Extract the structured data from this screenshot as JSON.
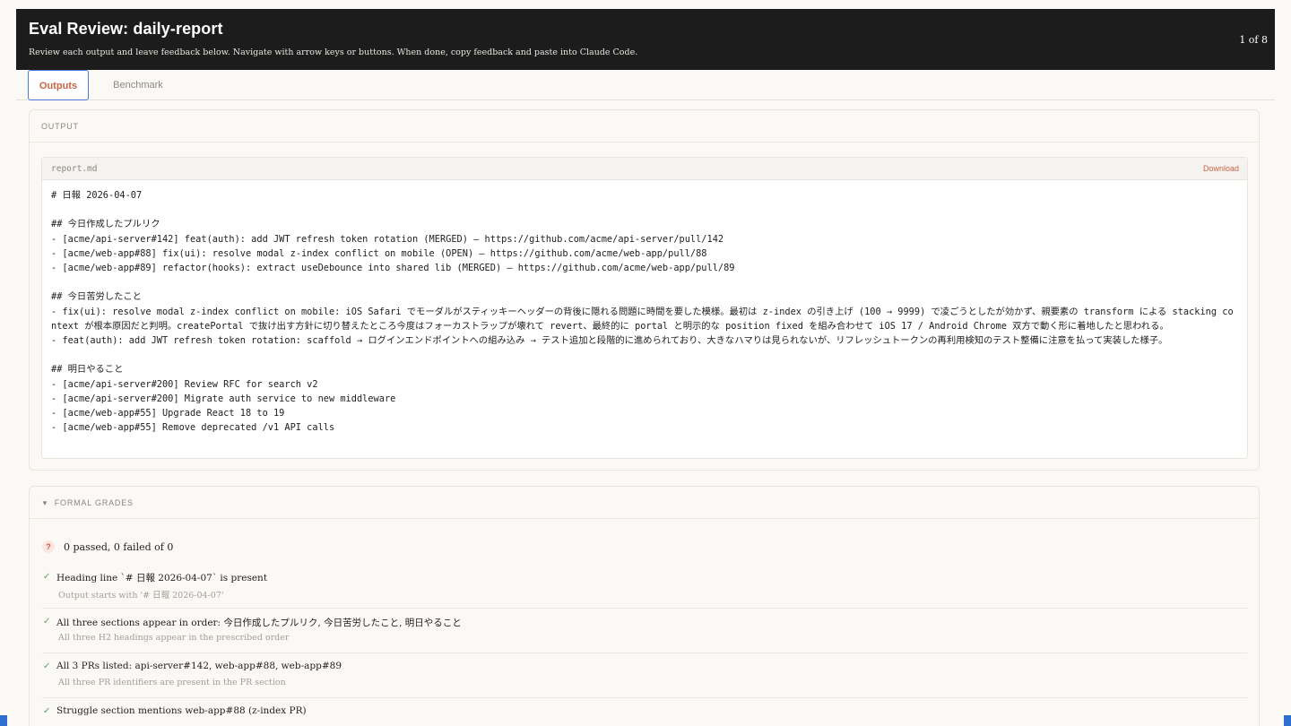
{
  "header": {
    "title": "Eval Review: daily-report",
    "subtitle": "Review each output and leave feedback below. Navigate with arrow keys or buttons. When done, copy feedback and paste into Claude Code.",
    "counter": "1 of 8"
  },
  "tabs": [
    {
      "label": "Outputs",
      "active": true
    },
    {
      "label": "Benchmark",
      "active": false
    }
  ],
  "output": {
    "section_label": "OUTPUT",
    "filename": "report.md",
    "download_label": "Download",
    "lines": [
      "# 日報 2026-04-07",
      "",
      "## 今日作成したプルリク",
      "- [acme/api-server#142] feat(auth): add JWT refresh token rotation (MERGED) — https://github.com/acme/api-server/pull/142",
      "- [acme/web-app#88] fix(ui): resolve modal z-index conflict on mobile (OPEN) — https://github.com/acme/web-app/pull/88",
      "- [acme/web-app#89] refactor(hooks): extract useDebounce into shared lib (MERGED) — https://github.com/acme/web-app/pull/89",
      "",
      "## 今日苦労したこと",
      "- fix(ui): resolve modal z-index conflict on mobile: iOS Safari でモーダルがスティッキーヘッダーの背後に隠れる問題に時間を要した模様。最初は z-index の引き上げ (100 → 9999) で凌ごうとしたが効かず、親要素の transform による stacking context が根本原因だと判明。createPortal で抜け出す方針に切り替えたところ今度はフォーカストラップが壊れて revert、最終的に portal と明示的な position fixed を組み合わせて iOS 17 / Android Chrome 双方で動く形に着地したと思われる。",
      "- feat(auth): add JWT refresh token rotation: scaffold → ログインエンドポイントへの組み込み → テスト追加と段階的に進められており、大きなハマりは見られないが、リフレッシュトークンの再利用検知のテスト整備に注意を払って実装した様子。",
      "",
      "## 明日やること",
      "- [acme/api-server#200] Review RFC for search v2",
      "- [acme/api-server#200] Migrate auth service to new middleware",
      "- [acme/web-app#55] Upgrade React 18 to 19",
      "- [acme/web-app#55] Remove deprecated /v1 API calls"
    ]
  },
  "grades": {
    "section_label": "FORMAL GRADES",
    "summary_icon": "?",
    "summary": "0 passed, 0 failed of 0",
    "items": [
      {
        "name": "Heading line `# 日報 2026-04-07` is present",
        "detail": "Output starts with '# 日報 2026-04-07'"
      },
      {
        "name": "All three sections appear in order: 今日作成したプルリク, 今日苦労したこと, 明日やること",
        "detail": "All three H2 headings appear in the prescribed order"
      },
      {
        "name": "All 3 PRs listed: api-server#142, web-app#88, web-app#89",
        "detail": "All three PR identifiers are present in the PR section"
      },
      {
        "name": "Struggle section mentions web-app#88 (z-index PR)",
        "detail": ""
      }
    ]
  }
}
